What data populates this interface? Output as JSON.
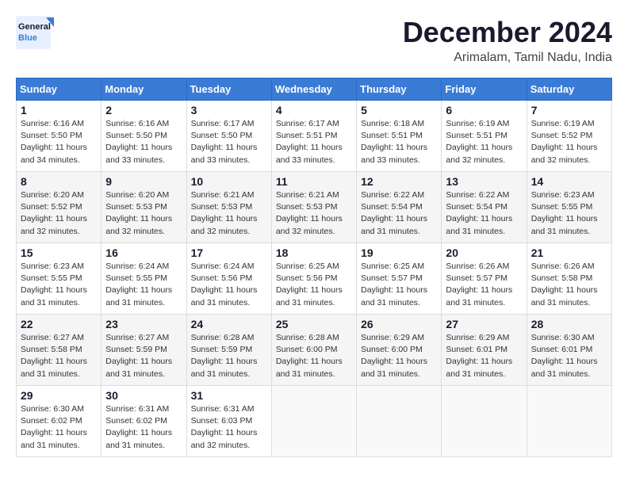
{
  "logo": {
    "line1": "General",
    "line2": "Blue"
  },
  "title": "December 2024",
  "location": "Arimalam, Tamil Nadu, India",
  "days_of_week": [
    "Sunday",
    "Monday",
    "Tuesday",
    "Wednesday",
    "Thursday",
    "Friday",
    "Saturday"
  ],
  "weeks": [
    [
      {
        "day": "1",
        "info": "Sunrise: 6:16 AM\nSunset: 5:50 PM\nDaylight: 11 hours\nand 34 minutes."
      },
      {
        "day": "2",
        "info": "Sunrise: 6:16 AM\nSunset: 5:50 PM\nDaylight: 11 hours\nand 33 minutes."
      },
      {
        "day": "3",
        "info": "Sunrise: 6:17 AM\nSunset: 5:50 PM\nDaylight: 11 hours\nand 33 minutes."
      },
      {
        "day": "4",
        "info": "Sunrise: 6:17 AM\nSunset: 5:51 PM\nDaylight: 11 hours\nand 33 minutes."
      },
      {
        "day": "5",
        "info": "Sunrise: 6:18 AM\nSunset: 5:51 PM\nDaylight: 11 hours\nand 33 minutes."
      },
      {
        "day": "6",
        "info": "Sunrise: 6:19 AM\nSunset: 5:51 PM\nDaylight: 11 hours\nand 32 minutes."
      },
      {
        "day": "7",
        "info": "Sunrise: 6:19 AM\nSunset: 5:52 PM\nDaylight: 11 hours\nand 32 minutes."
      }
    ],
    [
      {
        "day": "8",
        "info": "Sunrise: 6:20 AM\nSunset: 5:52 PM\nDaylight: 11 hours\nand 32 minutes."
      },
      {
        "day": "9",
        "info": "Sunrise: 6:20 AM\nSunset: 5:53 PM\nDaylight: 11 hours\nand 32 minutes."
      },
      {
        "day": "10",
        "info": "Sunrise: 6:21 AM\nSunset: 5:53 PM\nDaylight: 11 hours\nand 32 minutes."
      },
      {
        "day": "11",
        "info": "Sunrise: 6:21 AM\nSunset: 5:53 PM\nDaylight: 11 hours\nand 32 minutes."
      },
      {
        "day": "12",
        "info": "Sunrise: 6:22 AM\nSunset: 5:54 PM\nDaylight: 11 hours\nand 31 minutes."
      },
      {
        "day": "13",
        "info": "Sunrise: 6:22 AM\nSunset: 5:54 PM\nDaylight: 11 hours\nand 31 minutes."
      },
      {
        "day": "14",
        "info": "Sunrise: 6:23 AM\nSunset: 5:55 PM\nDaylight: 11 hours\nand 31 minutes."
      }
    ],
    [
      {
        "day": "15",
        "info": "Sunrise: 6:23 AM\nSunset: 5:55 PM\nDaylight: 11 hours\nand 31 minutes."
      },
      {
        "day": "16",
        "info": "Sunrise: 6:24 AM\nSunset: 5:55 PM\nDaylight: 11 hours\nand 31 minutes."
      },
      {
        "day": "17",
        "info": "Sunrise: 6:24 AM\nSunset: 5:56 PM\nDaylight: 11 hours\nand 31 minutes."
      },
      {
        "day": "18",
        "info": "Sunrise: 6:25 AM\nSunset: 5:56 PM\nDaylight: 11 hours\nand 31 minutes."
      },
      {
        "day": "19",
        "info": "Sunrise: 6:25 AM\nSunset: 5:57 PM\nDaylight: 11 hours\nand 31 minutes."
      },
      {
        "day": "20",
        "info": "Sunrise: 6:26 AM\nSunset: 5:57 PM\nDaylight: 11 hours\nand 31 minutes."
      },
      {
        "day": "21",
        "info": "Sunrise: 6:26 AM\nSunset: 5:58 PM\nDaylight: 11 hours\nand 31 minutes."
      }
    ],
    [
      {
        "day": "22",
        "info": "Sunrise: 6:27 AM\nSunset: 5:58 PM\nDaylight: 11 hours\nand 31 minutes."
      },
      {
        "day": "23",
        "info": "Sunrise: 6:27 AM\nSunset: 5:59 PM\nDaylight: 11 hours\nand 31 minutes."
      },
      {
        "day": "24",
        "info": "Sunrise: 6:28 AM\nSunset: 5:59 PM\nDaylight: 11 hours\nand 31 minutes."
      },
      {
        "day": "25",
        "info": "Sunrise: 6:28 AM\nSunset: 6:00 PM\nDaylight: 11 hours\nand 31 minutes."
      },
      {
        "day": "26",
        "info": "Sunrise: 6:29 AM\nSunset: 6:00 PM\nDaylight: 11 hours\nand 31 minutes."
      },
      {
        "day": "27",
        "info": "Sunrise: 6:29 AM\nSunset: 6:01 PM\nDaylight: 11 hours\nand 31 minutes."
      },
      {
        "day": "28",
        "info": "Sunrise: 6:30 AM\nSunset: 6:01 PM\nDaylight: 11 hours\nand 31 minutes."
      }
    ],
    [
      {
        "day": "29",
        "info": "Sunrise: 6:30 AM\nSunset: 6:02 PM\nDaylight: 11 hours\nand 31 minutes."
      },
      {
        "day": "30",
        "info": "Sunrise: 6:31 AM\nSunset: 6:02 PM\nDaylight: 11 hours\nand 31 minutes."
      },
      {
        "day": "31",
        "info": "Sunrise: 6:31 AM\nSunset: 6:03 PM\nDaylight: 11 hours\nand 32 minutes."
      },
      null,
      null,
      null,
      null
    ]
  ]
}
